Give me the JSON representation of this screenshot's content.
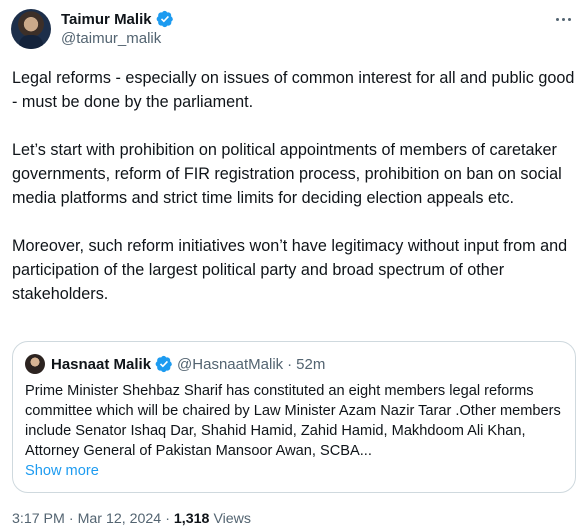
{
  "author": {
    "name": "Taimur Malik",
    "handle": "@taimur_malik",
    "verified": true
  },
  "tweet": {
    "paragraphs": [
      "Legal reforms - especially on issues of common interest for all and public good - must be done by the parliament.",
      "Let’s start with prohibition on political appointments of members of caretaker governments, reform of FIR registration process, prohibition on ban on social media platforms and strict time limits for deciding election appeals etc.",
      "Moreover, such reform initiatives won’t have legitimacy without input from and participation of the largest political party and broad spectrum of other stakeholders."
    ]
  },
  "quoted": {
    "name": "Hasnaat Malik",
    "handle": "@HasnaatMalik",
    "separator": "·",
    "time": "52m",
    "text": "Prime Minister Shehbaz Sharif has constituted an eight members legal reforms committee  which will be chaired by Law Minister Azam Nazir Tarar .Other members include Senator Ishaq Dar, Shahid Hamid,  Zahid Hamid, Makhdoom Ali Khan, Attorney General of Pakistan Mansoor Awan, SCBA...",
    "show_more": "Show more"
  },
  "meta": {
    "time": "3:17 PM",
    "separator": "·",
    "date": "Mar 12, 2024",
    "views_count": "1,318",
    "views_label": "Views"
  },
  "colors": {
    "verified_blue": "#1d9bf0",
    "secondary_text": "#536471",
    "border": "#cfd9de"
  },
  "icons": {
    "verified": "verified-badge-icon",
    "more": "more-options-icon"
  }
}
